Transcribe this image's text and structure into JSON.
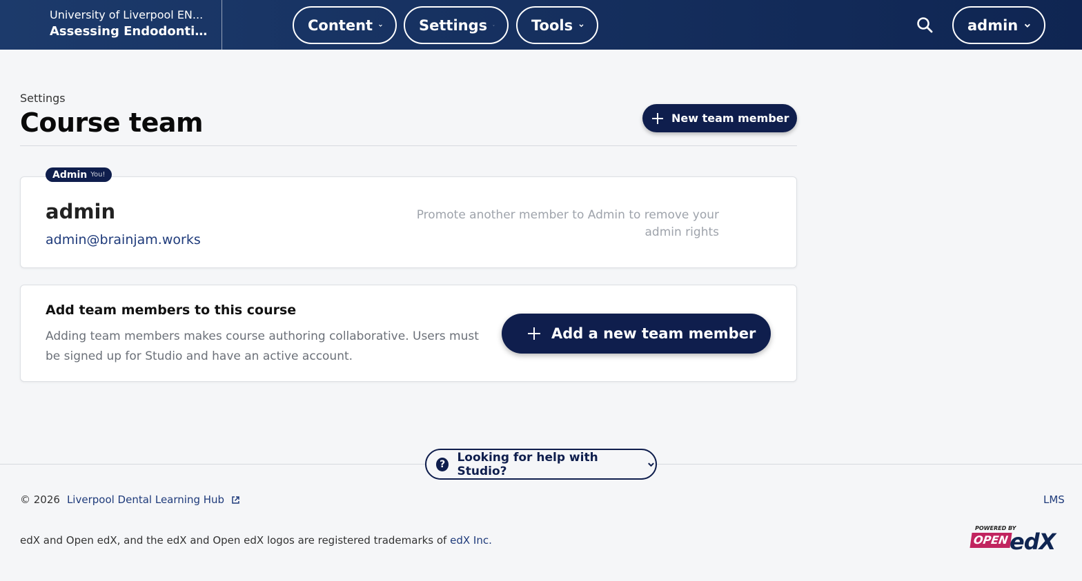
{
  "header": {
    "org_name": "University of Liverpool EN...",
    "course_name": "Assessing Endodonti...",
    "nav": {
      "content": "Content",
      "settings": "Settings",
      "tools": "Tools"
    },
    "user_menu": "admin"
  },
  "page": {
    "breadcrumb": "Settings",
    "title": "Course team",
    "new_member_button": "New team member"
  },
  "member_card": {
    "badge_role": "Admin",
    "badge_you": "You!",
    "name": "admin",
    "email": "admin@brainjam.works",
    "hint": "Promote another member to Admin to remove your admin rights"
  },
  "add_card": {
    "title": "Add team members to this course",
    "description": "Adding team members makes course authoring collaborative. Users must be signed up for Studio and have an active account.",
    "button": "Add a new team member"
  },
  "footer": {
    "help_button": "Looking for help with Studio?",
    "copyright": "© 2026",
    "hub_link": "Liverpool Dental Learning Hub",
    "lms_link": "LMS",
    "trademark_text": "edX and Open edX, and the edX and Open edX logos are registered trademarks of",
    "trademark_link": "edX Inc.",
    "logo_powered": "POWERED BY",
    "logo_open": "OPEN",
    "logo_edx": "edX"
  },
  "colors": {
    "header_bg": "#0f2552",
    "primary": "#0f1e4d",
    "link": "#1e3a7a",
    "open_edx_magenta": "#c1245f"
  }
}
